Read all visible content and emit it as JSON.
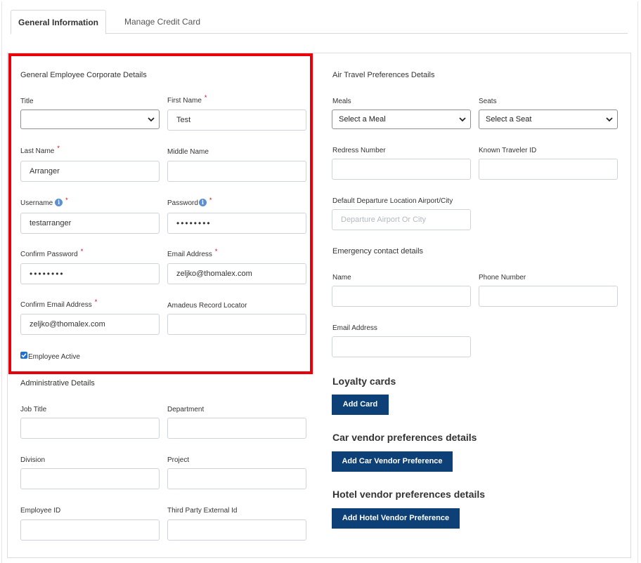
{
  "tabs": [
    {
      "label": "General Information",
      "active": true
    },
    {
      "label": "Manage Credit Card",
      "active": false
    }
  ],
  "employee": {
    "title": "General Employee Corporate Details",
    "title_label": "Title",
    "title_value": "",
    "first_name_label": "First Name",
    "first_name_value": "Test",
    "last_name_label": "Last Name",
    "last_name_value": "Arranger",
    "middle_name_label": "Middle Name",
    "middle_name_value": "",
    "username_label": "Username",
    "username_value": "testarranger",
    "password_label": "Password",
    "password_value": "••••••••",
    "confirm_password_label": "Confirm Password",
    "confirm_password_value": "••••••••",
    "email_label": "Email Address",
    "email_value": "zeljko@thomalex.com",
    "confirm_email_label": "Confirm Email Address",
    "confirm_email_value": "zeljko@thomalex.com",
    "amadeus_label": "Amadeus Record Locator",
    "amadeus_value": "",
    "active_label": "Employee Active",
    "active_checked": true,
    "required_mark": "*",
    "info_glyph": "i"
  },
  "admin": {
    "title": "Administrative Details",
    "job_title_label": "Job Title",
    "department_label": "Department",
    "division_label": "Division",
    "project_label": "Project",
    "employee_id_label": "Employee ID",
    "third_party_label": "Third Party External Id"
  },
  "air": {
    "title": "Air Travel Preferences Details",
    "meals_label": "Meals",
    "meals_value": "Select a Meal",
    "seats_label": "Seats",
    "seats_value": "Select a Seat",
    "redress_label": "Redress Number",
    "known_traveler_label": "Known Traveler ID",
    "departure_label": "Default Departure Location Airport/City",
    "departure_placeholder": "Departure Airport Or City"
  },
  "emergency": {
    "title": "Emergency contact details",
    "name_label": "Name",
    "phone_label": "Phone Number",
    "email_label": "Email Address"
  },
  "loyalty": {
    "title": "Loyalty cards",
    "button": "Add Card"
  },
  "car": {
    "title": "Car vendor preferences details",
    "button": "Add Car Vendor Preference"
  },
  "hotel": {
    "title": "Hotel vendor preferences details",
    "button": "Add Hotel Vendor Preference"
  },
  "colors": {
    "accent_button": "#0d4076",
    "highlight_border": "#e8000b",
    "required": "#d0021b",
    "info_icon": "#5b8fd6"
  }
}
